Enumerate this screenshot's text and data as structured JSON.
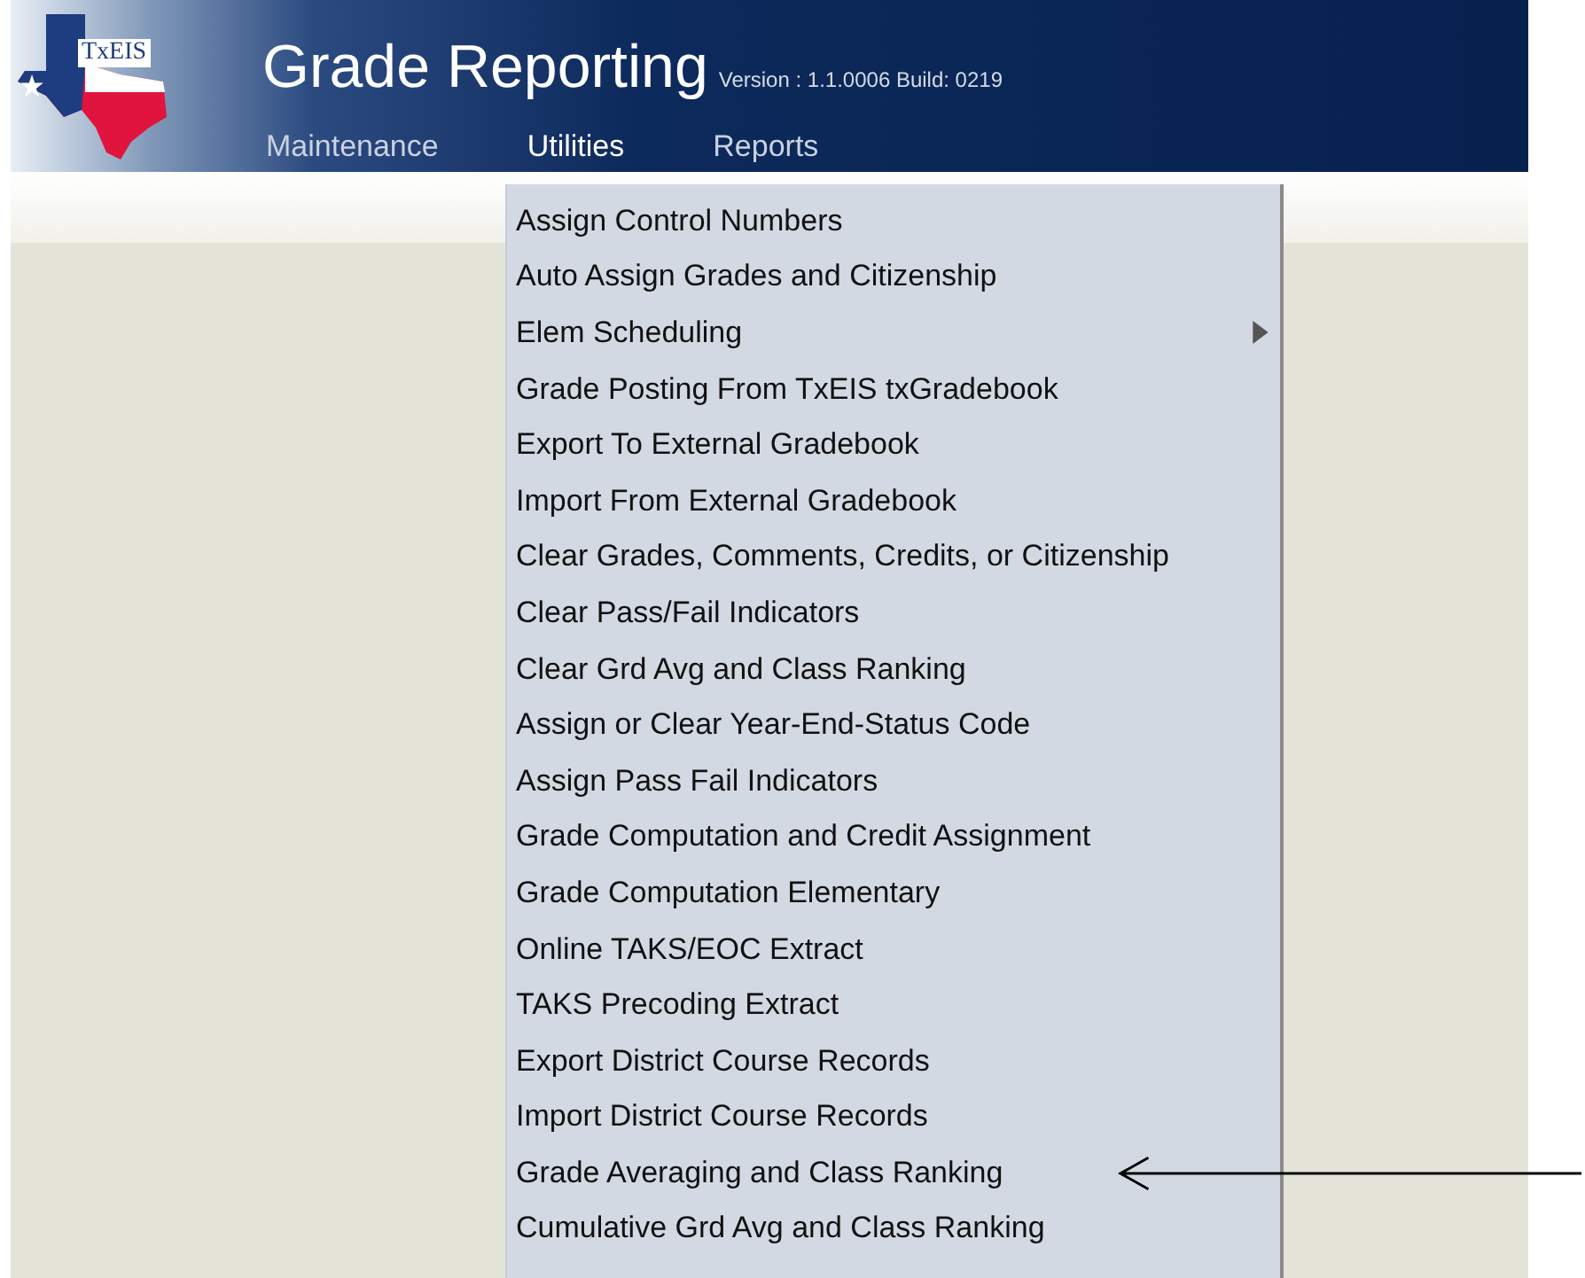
{
  "header": {
    "title": "Grade Reporting",
    "version": "Version : 1.1.0006 Build: 0219",
    "logo_text": "TxEIS"
  },
  "menu_bar": [
    {
      "label": "Maintenance",
      "selected": false
    },
    {
      "label": "Utilities",
      "selected": true
    },
    {
      "label": "Reports",
      "selected": false
    }
  ],
  "dropdown": {
    "items": [
      {
        "label": "Assign Control Numbers",
        "has_submenu": false
      },
      {
        "label": "Auto Assign Grades and Citizenship",
        "has_submenu": false
      },
      {
        "label": "Elem Scheduling",
        "has_submenu": true
      },
      {
        "label": "Grade Posting From TxEIS txGradebook",
        "has_submenu": false
      },
      {
        "label": "Export To External Gradebook",
        "has_submenu": false
      },
      {
        "label": "Import From External Gradebook",
        "has_submenu": false
      },
      {
        "label": "Clear Grades, Comments, Credits, or Citizenship",
        "has_submenu": false
      },
      {
        "label": "Clear Pass/Fail Indicators",
        "has_submenu": false
      },
      {
        "label": "Clear Grd Avg and Class Ranking",
        "has_submenu": false
      },
      {
        "label": "Assign or Clear Year-End-Status Code",
        "has_submenu": false
      },
      {
        "label": "Assign Pass Fail Indicators",
        "has_submenu": false
      },
      {
        "label": "Grade Computation and Credit Assignment",
        "has_submenu": false
      },
      {
        "label": "Grade Computation Elementary",
        "has_submenu": false
      },
      {
        "label": "Online TAKS/EOC Extract",
        "has_submenu": false
      },
      {
        "label": "TAKS Precoding Extract",
        "has_submenu": false
      },
      {
        "label": "Export District Course Records",
        "has_submenu": false
      },
      {
        "label": "Import District Course Records",
        "has_submenu": false
      },
      {
        "label": "Grade Averaging and Class Ranking",
        "has_submenu": false,
        "annotated": true
      },
      {
        "label": "Cumulative Grd Avg and Class Ranking",
        "has_submenu": false
      }
    ]
  }
}
